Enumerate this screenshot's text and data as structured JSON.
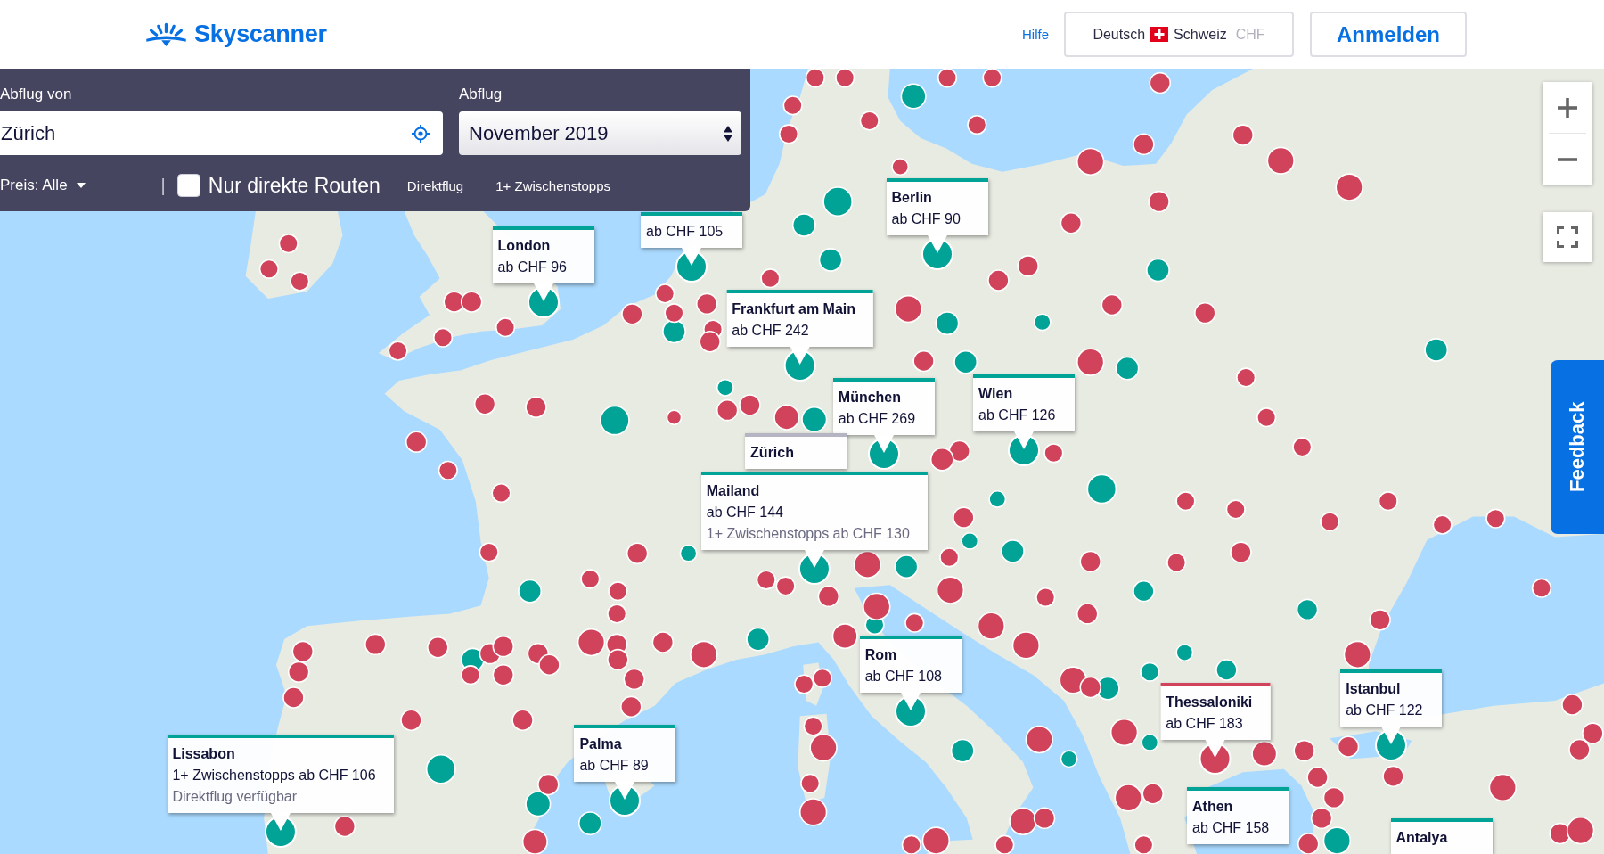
{
  "header": {
    "logo": "Skyscanner",
    "help_link": "Hilfe",
    "locale": {
      "language": "Deutsch",
      "country": "Schweiz",
      "currency": "CHF"
    },
    "login_button": "Anmelden"
  },
  "search_panel": {
    "origin": {
      "label": "Abflug von",
      "value": "Zürich"
    },
    "departure": {
      "label": "Abflug",
      "value": "November 2019"
    },
    "price_filter": "Preis: Alle",
    "separator": "|",
    "direct_only": {
      "label": "Nur direkte Routen",
      "checked": false
    },
    "route_types": [
      "Direktflug",
      "1+ Zwischenstopps"
    ]
  },
  "map": {
    "marker_series": [
      {
        "kind": "direct",
        "color": "#00a396"
      },
      {
        "kind": "stopover",
        "color": "#d1435b"
      }
    ],
    "popups": [
      {
        "kind": "direct",
        "city": "Berlin",
        "lines": [
          {
            "text": "ab CHF 90",
            "muted": false
          }
        ]
      },
      {
        "kind": "direct",
        "lines": [
          {
            "text": "ab CHF 105",
            "muted": false
          }
        ]
      },
      {
        "kind": "direct",
        "city": "London",
        "lines": [
          {
            "text": "ab CHF 96",
            "muted": false
          }
        ]
      },
      {
        "kind": "direct",
        "city": "Frankfurt am Main",
        "lines": [
          {
            "text": "ab CHF 242",
            "muted": false
          }
        ]
      },
      {
        "kind": "direct",
        "city": "München",
        "lines": [
          {
            "text": "ab CHF 269",
            "muted": false
          }
        ]
      },
      {
        "kind": "direct",
        "city": "Wien",
        "lines": [
          {
            "text": "ab CHF 126",
            "muted": false
          }
        ]
      },
      {
        "kind": "origin",
        "city": "Zürich"
      },
      {
        "kind": "direct",
        "city": "Mailand",
        "lines": [
          {
            "text": "ab CHF 144",
            "muted": false
          },
          {
            "text": "1+ Zwischenstopps ab CHF 130",
            "muted": true
          }
        ]
      },
      {
        "kind": "direct",
        "city": "Rom",
        "lines": [
          {
            "text": "ab CHF 108",
            "muted": false
          }
        ]
      },
      {
        "kind": "direct",
        "city": "Istanbul",
        "lines": [
          {
            "text": "ab CHF 122",
            "muted": false
          }
        ]
      },
      {
        "kind": "stopover",
        "city": "Thessaloniki",
        "lines": [
          {
            "text": "ab CHF 183",
            "muted": false
          }
        ]
      },
      {
        "kind": "direct",
        "city": "Palma",
        "lines": [
          {
            "text": "ab CHF 89",
            "muted": false
          }
        ]
      },
      {
        "kind": "direct",
        "city": "Lissabon",
        "lines": [
          {
            "text": "1+ Zwischenstopps ab CHF 106",
            "muted": false
          },
          {
            "text": "Direktflug verfügbar",
            "muted": true
          }
        ]
      },
      {
        "kind": "direct",
        "city": "Athen",
        "lines": [
          {
            "text": "ab CHF 158",
            "muted": false
          }
        ]
      },
      {
        "kind": "direct",
        "city": "Antalya"
      }
    ],
    "feedback_tab": "Feedback"
  }
}
